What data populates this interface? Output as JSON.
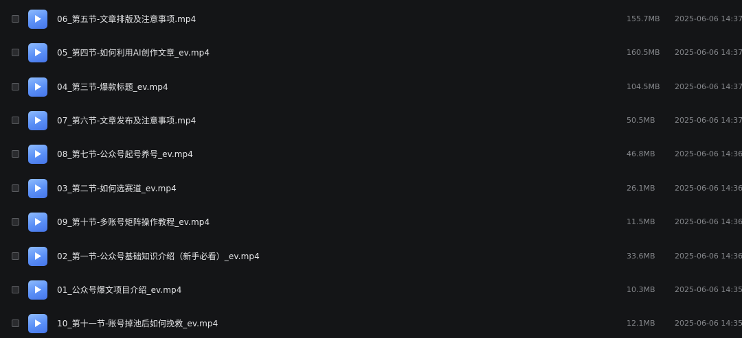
{
  "files": [
    {
      "name": "06_第五节-文章排版及注意事项.mp4",
      "size": "155.7MB",
      "modified": "2025-06-06 14:37",
      "icon": "video-file-icon"
    },
    {
      "name": "05_第四节-如何利用AI创作文章_ev.mp4",
      "size": "160.5MB",
      "modified": "2025-06-06 14:37",
      "icon": "video-file-icon"
    },
    {
      "name": "04_第三节-爆款标题_ev.mp4",
      "size": "104.5MB",
      "modified": "2025-06-06 14:37",
      "icon": "video-file-icon"
    },
    {
      "name": "07_第六节-文章发布及注意事项.mp4",
      "size": "50.5MB",
      "modified": "2025-06-06 14:37",
      "icon": "video-file-icon"
    },
    {
      "name": "08_第七节-公众号起号养号_ev.mp4",
      "size": "46.8MB",
      "modified": "2025-06-06 14:36",
      "icon": "video-file-icon"
    },
    {
      "name": "03_第二节-如何选赛道_ev.mp4",
      "size": "26.1MB",
      "modified": "2025-06-06 14:36",
      "icon": "video-file-icon"
    },
    {
      "name": "09_第十节-多账号矩阵操作教程_ev.mp4",
      "size": "11.5MB",
      "modified": "2025-06-06 14:36",
      "icon": "video-file-icon"
    },
    {
      "name": "02_第一节-公众号基础知识介绍（新手必看）_ev.mp4",
      "size": "33.6MB",
      "modified": "2025-06-06 14:36",
      "icon": "video-file-icon"
    },
    {
      "name": "01_公众号爆文项目介绍_ev.mp4",
      "size": "10.3MB",
      "modified": "2025-06-06 14:35",
      "icon": "video-file-icon"
    },
    {
      "name": "10_第十一节-账号掉池后如何挽救_ev.mp4",
      "size": "12.1MB",
      "modified": "2025-06-06 14:35",
      "icon": "video-file-icon"
    }
  ],
  "colors": {
    "background": "#141517",
    "icon_gradient_top": "#8fbcfd",
    "icon_gradient_bottom": "#4676ea",
    "name_text": "#e3e4e6",
    "meta_text": "#85878b"
  }
}
